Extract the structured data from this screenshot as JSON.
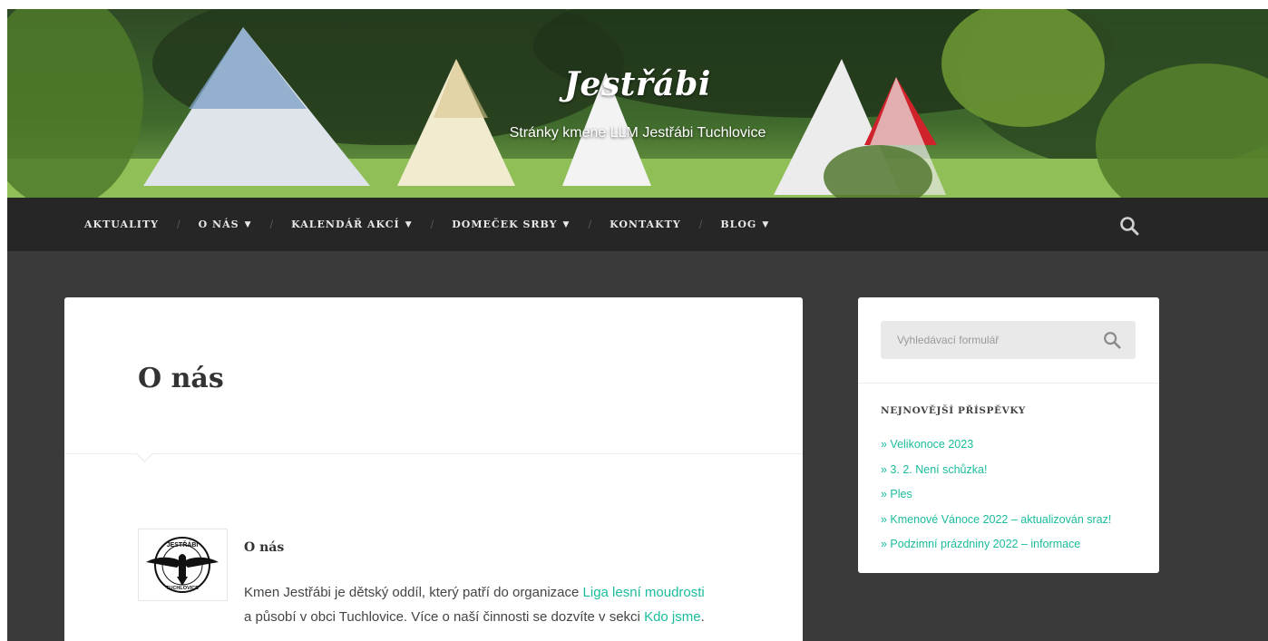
{
  "header": {
    "site_title": "Jestřábi",
    "tagline": "Stránky kmene LLM Jestřábi Tuchlovice"
  },
  "nav": {
    "items": [
      {
        "label": "AKTUALITY",
        "dropdown": false
      },
      {
        "label": "O NÁS",
        "dropdown": true
      },
      {
        "label": "KALENDÁŘ AKCÍ",
        "dropdown": true
      },
      {
        "label": "DOMEČEK SRBY",
        "dropdown": true
      },
      {
        "label": "KONTAKTY",
        "dropdown": false
      },
      {
        "label": "BLOG",
        "dropdown": true
      }
    ],
    "separator": "/",
    "search_icon": "search-icon"
  },
  "main": {
    "page_title": "O nás",
    "about_heading": "O nás",
    "about_text_1": "Kmen Jestřábi je dětský oddíl, který patří do organizace ",
    "about_link_1": "Liga lesní moudrosti",
    "about_text_2": "a působí v obci Tuchlovice. Více o naší činnosti se dozvíte v sekci ",
    "about_link_2": "Kdo jsme",
    "about_text_3": ".",
    "logo": {
      "text_top": "JESTŘÁBI",
      "text_bottom": "TUCHLOVICE"
    }
  },
  "sidebar": {
    "search_placeholder": "Vyhledávací formulář",
    "recent_title": "NEJNOVĚJŠÍ PŘÍSPĚVKY",
    "recent_posts": [
      "» Velikonoce 2023",
      "» 3. 2. Není schůzka!",
      "» Ples",
      "» Kmenové Vánoce 2022 – aktualizován sraz!",
      "» Podzimní prázdniny 2022 – informace"
    ]
  },
  "colors": {
    "accent": "#1abc9c",
    "nav_bg": "#262626",
    "page_bg": "#3a3a3a"
  }
}
